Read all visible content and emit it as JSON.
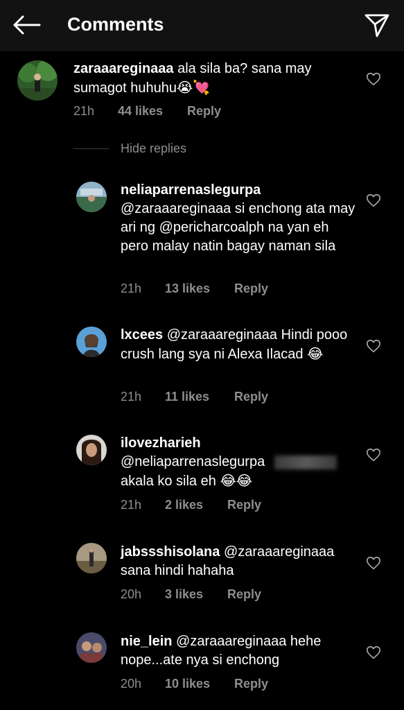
{
  "header": {
    "title": "Comments"
  },
  "parent_comment": {
    "username": "zaraaareginaaa",
    "text": " ala sila ba? sana may sumagot huhuhu",
    "emojis": "😭💘",
    "time": "21h",
    "likes": "44 likes",
    "reply": "Reply"
  },
  "hide_replies": "Hide replies",
  "replies": [
    {
      "username": "neliaparrenaslegurpa",
      "text": "@zaraaareginaaa si enchong ata may ari ng @pericharcoalph na yan eh pero malay natin bagay naman sila",
      "time": "21h",
      "likes": "13 likes",
      "reply": "Reply"
    },
    {
      "username": "lxcees",
      "text": " @zaraaareginaaa Hindi pooo crush lang sya ni Alexa Ilacad",
      "emojis": "😂",
      "time": "21h",
      "likes": "11 likes",
      "reply": "Reply"
    },
    {
      "username": "ilovezharieh",
      "text_line1": "@neliaparrenaslegurpa",
      "text_line2": "akala ko sila eh",
      "emojis": "😂😂",
      "time": "21h",
      "likes": "2 likes",
      "reply": "Reply"
    },
    {
      "username": "jabssshisolana",
      "text": " @zaraaareginaaa sana hindi hahaha",
      "time": "20h",
      "likes": "3 likes",
      "reply": "Reply"
    },
    {
      "username": "nie_lein",
      "text": " @zaraaareginaaa hehe nope...ate nya si enchong",
      "time": "20h",
      "likes": "10 likes",
      "reply": "Reply"
    }
  ],
  "colors": {
    "background": "#000000",
    "header": "#121212",
    "secondary_text": "#8e8e8e"
  }
}
